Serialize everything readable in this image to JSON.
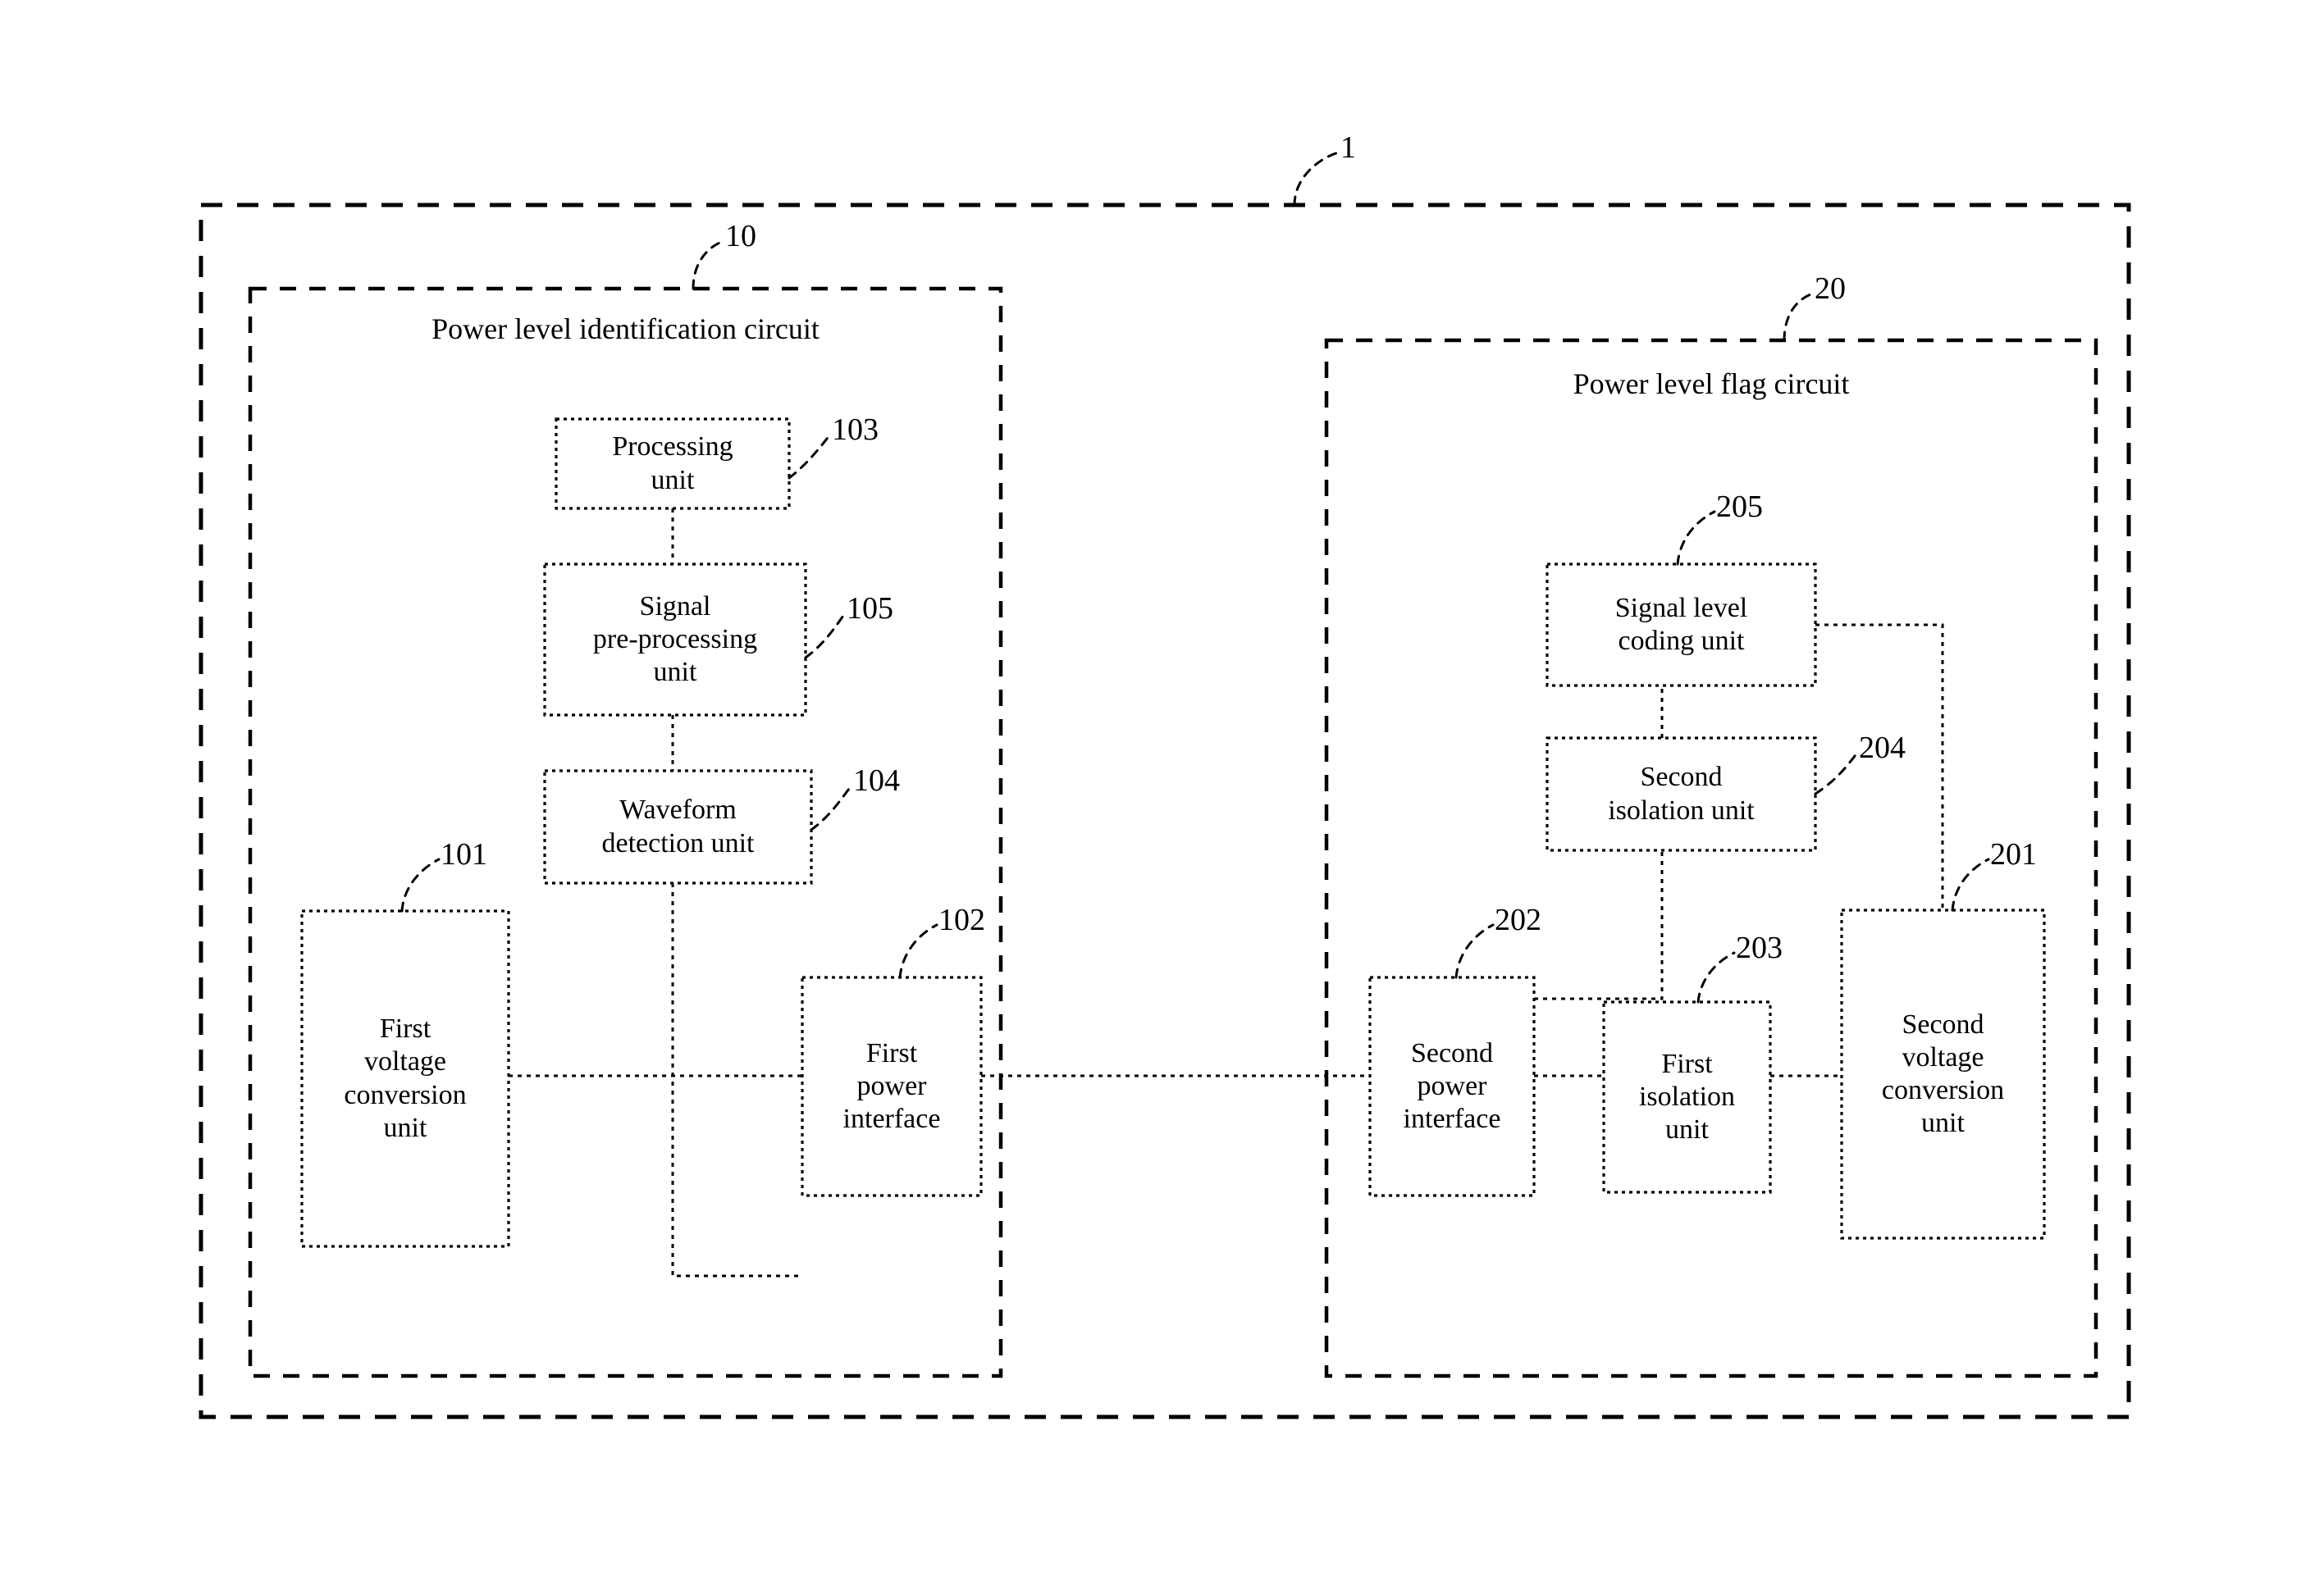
{
  "figure": {
    "type": "patent-block-diagram",
    "overall_ref": "1",
    "groups": [
      {
        "id": "power-level-identification-circuit",
        "title": "Power level identification circuit",
        "ref": "10"
      },
      {
        "id": "power-level-flag-circuit",
        "title": "Power level flag circuit",
        "ref": "20"
      }
    ],
    "blocks": [
      {
        "id": "processing-unit",
        "label": "Processing\nunit",
        "ref": "103",
        "group": "10"
      },
      {
        "id": "signal-pre-processing-unit",
        "label": "Signal\npre-processing\nunit",
        "ref": "105",
        "group": "10"
      },
      {
        "id": "waveform-detection-unit",
        "label": "Waveform\ndetection unit",
        "ref": "104",
        "group": "10"
      },
      {
        "id": "first-voltage-conversion-unit",
        "label": "First\nvoltage\nconversion\nunit",
        "ref": "101",
        "group": "10"
      },
      {
        "id": "first-power-interface",
        "label": "First\npower\ninterface",
        "ref": "102",
        "group": "10"
      },
      {
        "id": "signal-level-coding-unit",
        "label": "Signal level\ncoding unit",
        "ref": "205",
        "group": "20"
      },
      {
        "id": "second-isolation-unit",
        "label": "Second\nisolation unit",
        "ref": "204",
        "group": "20"
      },
      {
        "id": "second-power-interface",
        "label": "Second\npower\ninterface",
        "ref": "202",
        "group": "20"
      },
      {
        "id": "first-isolation-unit",
        "label": "First\nisolation\nunit",
        "ref": "203",
        "group": "20"
      },
      {
        "id": "second-voltage-conversion-unit",
        "label": "Second\nvoltage\nconversion\nunit",
        "ref": "201",
        "group": "20"
      }
    ],
    "connections": [
      {
        "from": "processing-unit",
        "to": "signal-pre-processing-unit"
      },
      {
        "from": "signal-pre-processing-unit",
        "to": "waveform-detection-unit"
      },
      {
        "from": "waveform-detection-unit",
        "to": "first-power-interface"
      },
      {
        "from": "first-voltage-conversion-unit",
        "to": "first-power-interface"
      },
      {
        "from": "first-power-interface",
        "to": "second-power-interface"
      },
      {
        "from": "second-power-interface",
        "to": "first-isolation-unit"
      },
      {
        "from": "first-isolation-unit",
        "to": "second-voltage-conversion-unit"
      },
      {
        "from": "second-power-interface",
        "to": "second-isolation-unit"
      },
      {
        "from": "second-isolation-unit",
        "to": "signal-level-coding-unit"
      },
      {
        "from": "signal-level-coding-unit",
        "to": "second-voltage-conversion-unit"
      }
    ],
    "colors": {
      "ink": "#000000",
      "background": "#ffffff"
    }
  },
  "labels": {
    "overall": "1",
    "group10_ref": "10",
    "group20_ref": "20",
    "group10_title": "Power level identification circuit",
    "group20_title": "Power level flag circuit",
    "ref_103": "103",
    "ref_105": "105",
    "ref_104": "104",
    "ref_101": "101",
    "ref_102": "102",
    "ref_205": "205",
    "ref_204": "204",
    "ref_202": "202",
    "ref_203": "203",
    "ref_201": "201",
    "processing_unit": "Processing\nunit",
    "signal_pre_processing_unit": "Signal\npre-processing\nunit",
    "waveform_detection_unit": "Waveform\ndetection unit",
    "first_voltage_conversion_unit": "First\nvoltage\nconversion\nunit",
    "first_power_interface": "First\npower\ninterface",
    "signal_level_coding_unit": "Signal level\ncoding unit",
    "second_isolation_unit": "Second\nisolation unit",
    "second_power_interface": "Second\npower\ninterface",
    "first_isolation_unit": "First\nisolation\nunit",
    "second_voltage_conversion_unit": "Second\nvoltage\nconversion\nunit"
  }
}
